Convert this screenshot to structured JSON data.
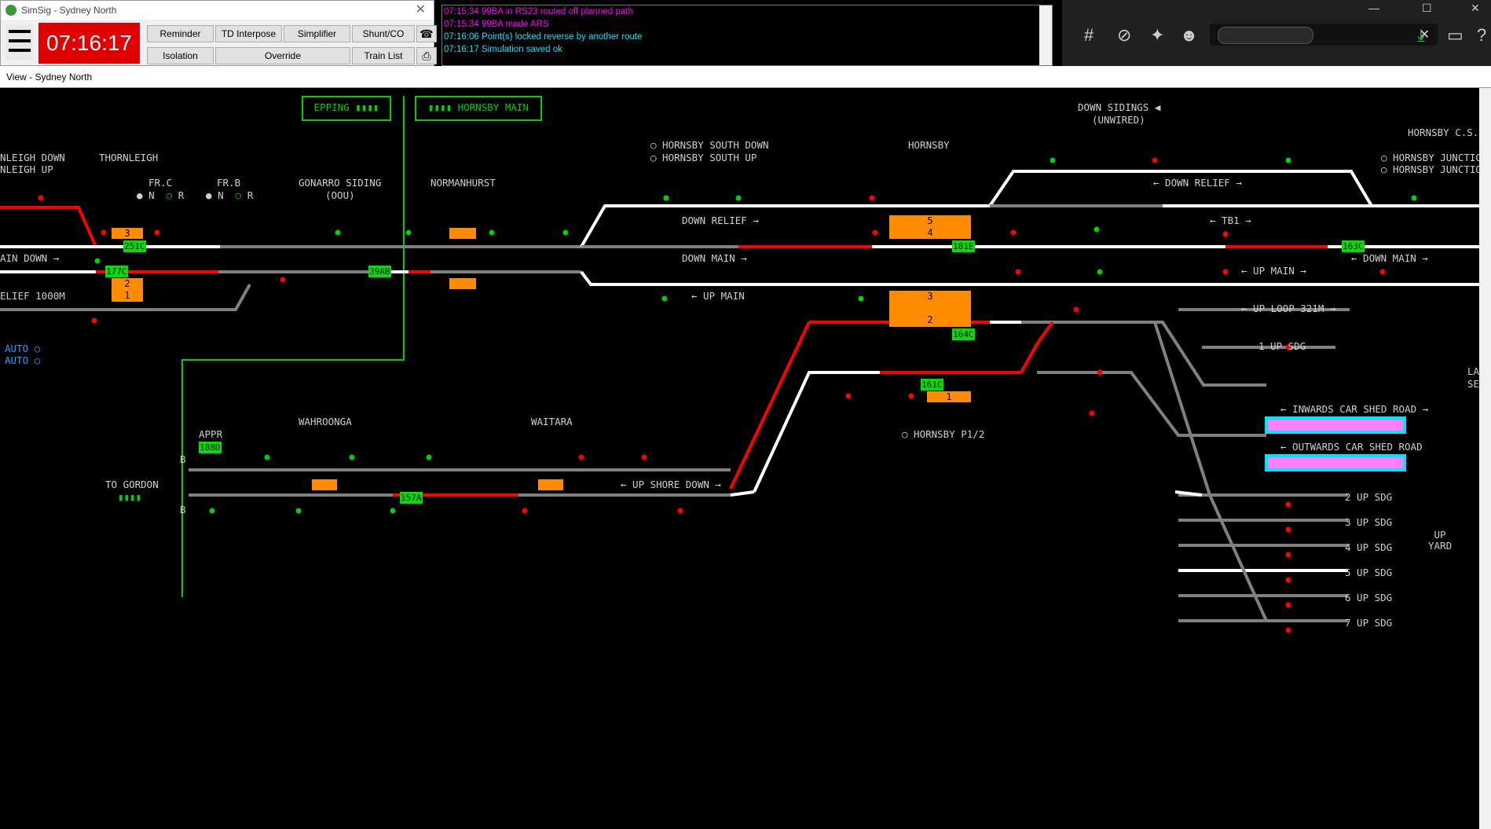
{
  "window": {
    "title": "SimSig - Sydney North",
    "clock": "07:16:17",
    "buttons": [
      "Reminder",
      "TD Interpose",
      "Simplifier",
      "Shunt/CO",
      "Isolation",
      "Override",
      "Train List"
    ],
    "close_glyph": "✕"
  },
  "messages": [
    {
      "text": "07:15:34 99BA in RS23 routed off planned path",
      "color": "#ff00ff"
    },
    {
      "text": "07:15:34 99BA made ARS",
      "color": "#ff00ff"
    },
    {
      "text": "07:16:06 Point(s) locked reverse by another route",
      "color": "#00e5ff"
    },
    {
      "text": "07:16:17 Simulation saved ok",
      "color": "#00e5ff"
    }
  ],
  "view_title": "View - Sydney North",
  "panels": {
    "epping": "EPPING",
    "hornsby_main": "HORNSBY MAIN"
  },
  "labels": {
    "thornleigh": "THORNLEIGH",
    "nleigh_down": "NLEIGH DOWN",
    "nleigh_up": "NLEIGH UP",
    "frc": "FR.C",
    "frb": "FR.B",
    "n": "N",
    "r": "R",
    "gonarro": "GONARRO SIDING",
    "oou": "(OOU)",
    "normanhurst": "NORMANHURST",
    "ain_down": "AIN DOWN →",
    "elief": "ELIEF 1000M",
    "auto": "AUTO ○",
    "hsd": "○ HORNSBY SOUTH DOWN",
    "hsu": "○ HORNSBY SOUTH UP",
    "hornsby": "HORNSBY",
    "down_relief": "DOWN RELIEF →",
    "down_main": "DOWN MAIN →",
    "up_main": "← UP MAIN",
    "down_sidings": "DOWN SIDINGS ◀",
    "unwired": "(UNWIRED)",
    "hornsby_cs": "HORNSBY C.S.",
    "hj1": "○ HORNSBY JUNCTION",
    "hj2": "○ HORNSBY JUNCTION",
    "r_down_relief": "← DOWN RELIEF →",
    "tb1": "← TB1 →",
    "r_down_main": "← DOWN MAIN →",
    "r_up_main": "← UP MAIN →",
    "up_loop": "← UP LOOP 321M →",
    "up_sdg1": "1 UP SDG",
    "inwards": "← INWARDS CAR SHED ROAD →",
    "outwards": "← OUTWARDS CAR SHED ROAD",
    "last": "LAST",
    "sent": "SENT",
    "hornsby_p12": "○ HORNSBY P1/2",
    "wahroonga": "WAHROONGA",
    "waitara": "WAITARA",
    "appr": "APPR",
    "to_gordon": "TO GORDON",
    "b": "B",
    "up_shore_down": "← UP SHORE DOWN →",
    "sdg2": "2 UP SDG",
    "sdg3": "3 UP SDG",
    "sdg4": "4 UP SDG",
    "sdg5": "5 UP SDG",
    "sdg6": "6 UP SDG",
    "sdg7": "7 UP SDG",
    "up_yard": "UP\nYARD"
  },
  "berths": {
    "b251c": "251C",
    "b177c": "177C",
    "b39ab": "39AB",
    "b181e": "181E",
    "b164c": "164C",
    "b161c": "161C",
    "b163c": "163C",
    "b188d": "188D",
    "b157a": "157A"
  },
  "platform_numbers": {
    "p3a": "3",
    "p2a": "2",
    "p1a": "1",
    "p5": "5",
    "p4": "4",
    "p3b": "3",
    "p2b": "2",
    "p1b": "1"
  },
  "colors": {
    "track_white": "#ffffff",
    "track_grey": "#808080",
    "route_red": "#ff0000",
    "berth_green": "#00e000",
    "platform_orange": "#ff8c00",
    "panel_green": "#00d000",
    "sidings_cyan": "#00e5ff",
    "sidings_magenta": "#ff80ff"
  }
}
